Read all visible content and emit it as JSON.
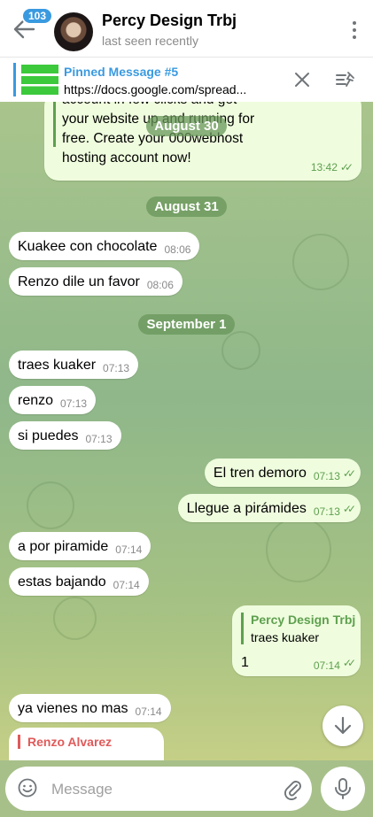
{
  "header": {
    "unread_badge": "103",
    "title": "Percy Design Trbj",
    "status": "last seen recently"
  },
  "pinned": {
    "title": "Pinned Message #5",
    "text": "https://docs.google.com/spread..."
  },
  "earlier_message": {
    "lines": [
      "account in few clicks and get",
      "your website up and running for",
      "free. Create your 000webhost",
      "hosting account now!"
    ],
    "time": "13:42"
  },
  "dates": {
    "d1": "August 30",
    "d2": "August 31",
    "d3": "September 1"
  },
  "messages": [
    {
      "text": "Kuakee con chocolate",
      "time": "08:06"
    },
    {
      "text": "Renzo dile un favor",
      "time": "08:06"
    },
    {
      "text": "traes kuaker",
      "time": "07:13"
    },
    {
      "text": "renzo",
      "time": "07:13"
    },
    {
      "text": "si puedes",
      "time": "07:13"
    },
    {
      "text": "El tren demoro",
      "time": "07:13"
    },
    {
      "text": "Llegue a pirámides",
      "time": "07:13"
    },
    {
      "text": "a por piramide",
      "time": "07:14"
    },
    {
      "text": "estas bajando",
      "time": "07:14"
    },
    {
      "text": "1",
      "time": "07:14"
    },
    {
      "text": "ya vienes no mas",
      "time": "07:14"
    }
  ],
  "reply": {
    "name": "Percy Design Trbj",
    "text": "traes kuaker"
  },
  "partial_reply": {
    "name": "Renzo Alvarez"
  },
  "composer": {
    "placeholder": "Message"
  },
  "colors": {
    "accent": "#3a9ae0",
    "outgoing_bubble": "#effdde",
    "check_green": "#5ea04f"
  }
}
